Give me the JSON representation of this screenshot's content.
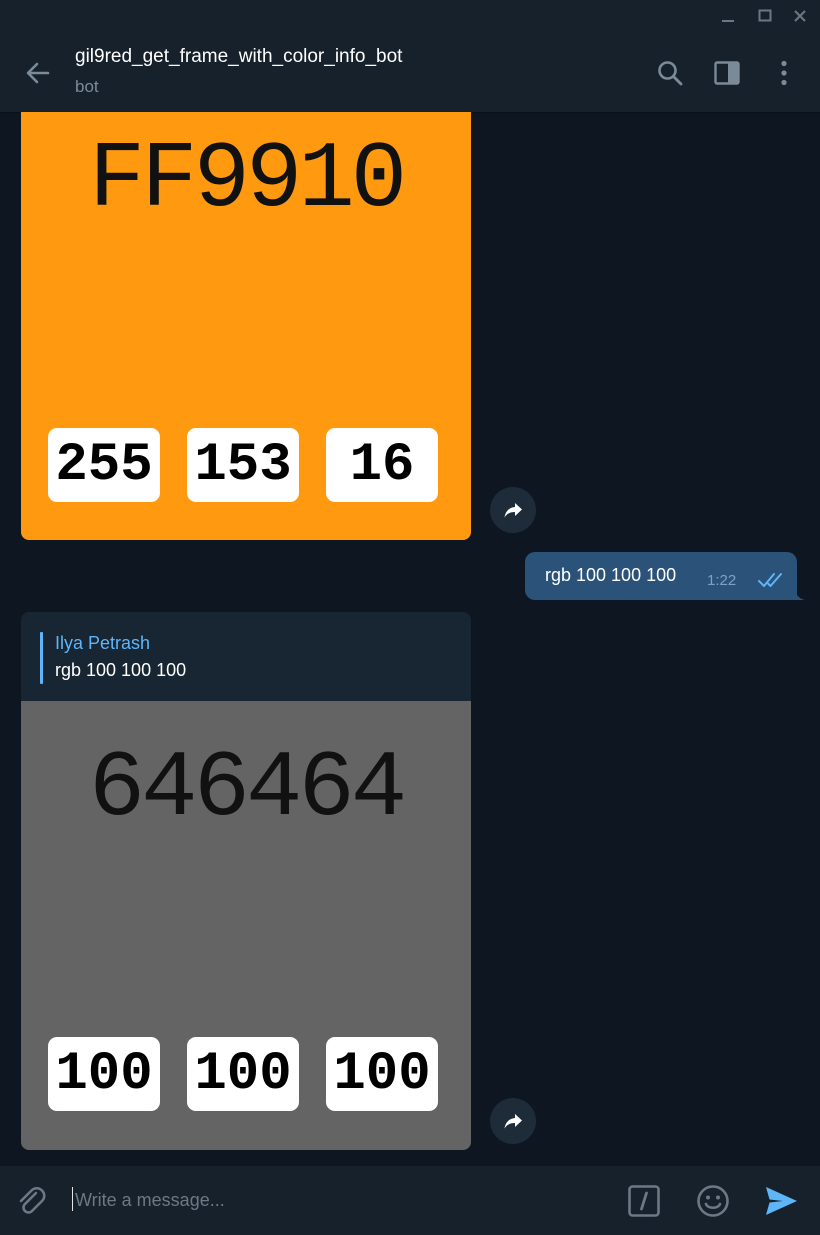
{
  "window": {
    "buttons": [
      "minimize",
      "maximize",
      "close"
    ]
  },
  "header": {
    "title": "gil9red_get_frame_with_color_info_bot",
    "subtitle": "bot",
    "icons": [
      "back-arrow-icon",
      "search-icon",
      "sidebar-toggle-icon",
      "more-vert-icon"
    ]
  },
  "messages": [
    {
      "type": "color_image",
      "hex": "FF9910",
      "background": "#ff9910",
      "rgb": [
        "255",
        "153",
        "16"
      ]
    },
    {
      "type": "outgoing_text",
      "text": "rgb 100 100 100",
      "time": "1:22",
      "status": "read"
    },
    {
      "type": "color_image_reply",
      "reply": {
        "author": "Ilya Petrash",
        "text": "rgb 100 100 100"
      },
      "hex": "646464",
      "background": "#646464",
      "rgb": [
        "100",
        "100",
        "100"
      ]
    }
  ],
  "composer": {
    "placeholder": "Write a message...",
    "icons": [
      "attach-icon",
      "bot-commands-icon",
      "emoji-icon",
      "send-icon"
    ]
  },
  "colors": {
    "accent": "#5eb5f7",
    "outgoing_bubble": "#2b5278",
    "chat_bg": "#0e1621",
    "panel_bg": "#17212b"
  }
}
